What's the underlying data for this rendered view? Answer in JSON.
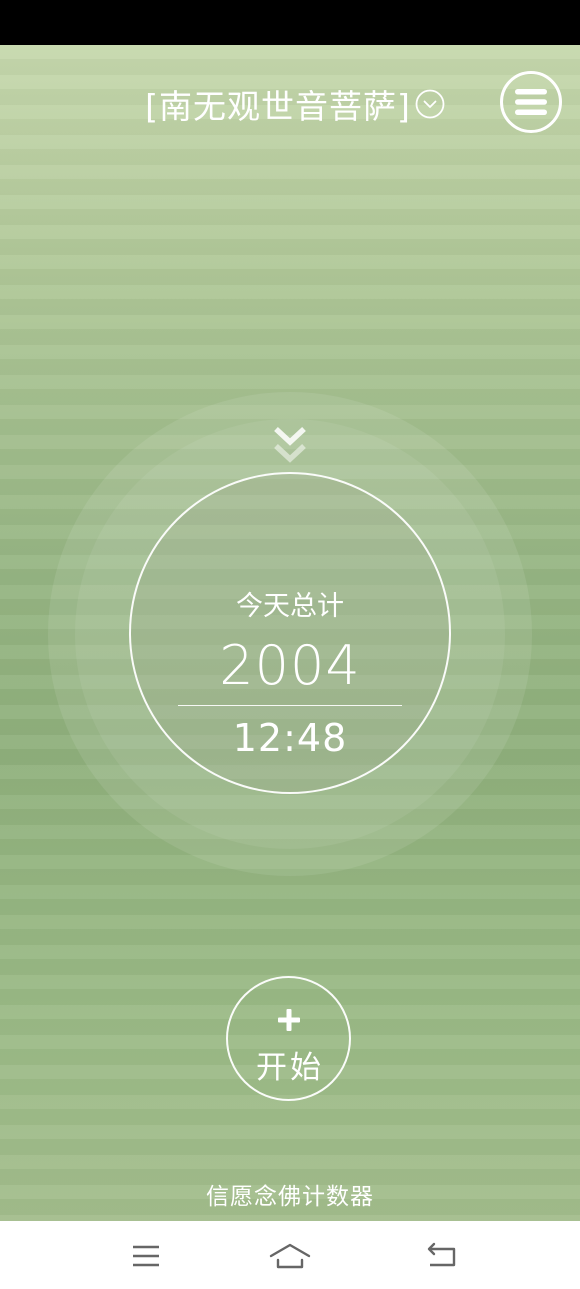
{
  "header": {
    "title": "[南无观世音菩萨]",
    "title_dropdown_icon": "chevron-down-circle-icon",
    "menu_icon": "hamburger-menu-icon"
  },
  "counter": {
    "label": "今天总计",
    "count": "2004",
    "time": "12:48",
    "indicator_icon": "double-chevron-down-icon"
  },
  "start_button": {
    "icon": "plus-icon",
    "label": "开始"
  },
  "footer": {
    "app_name": "信愿念佛计数器"
  },
  "nav_bar": {
    "icons": [
      "menu-recents-icon",
      "home-icon",
      "back-icon"
    ]
  },
  "colors": {
    "bg_top": "#c6d8ad",
    "bg_mid": "#96b583",
    "bg_bottom": "#a3bd8c",
    "text": "#ffffff",
    "status_bar": "#000000",
    "nav_bar": "#ffffff",
    "nav_icon": "#666666"
  }
}
